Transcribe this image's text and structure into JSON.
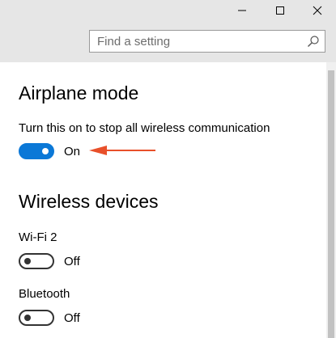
{
  "window": {
    "controls": [
      "minimize",
      "maximize",
      "close"
    ]
  },
  "search": {
    "placeholder": "Find a setting",
    "icon": "search-icon"
  },
  "airplane_mode": {
    "title": "Airplane mode",
    "description": "Turn this on to stop all wireless communication",
    "state_label": "On",
    "enabled": true
  },
  "wireless_devices": {
    "title": "Wireless devices",
    "devices": [
      {
        "label": "Wi-Fi 2",
        "state_label": "Off",
        "enabled": false
      },
      {
        "label": "Bluetooth",
        "state_label": "Off",
        "enabled": false
      }
    ]
  },
  "colors": {
    "accent": "#0b78d7",
    "annotation_arrow": "#e8502a",
    "header_bg": "#e6e6e6"
  }
}
